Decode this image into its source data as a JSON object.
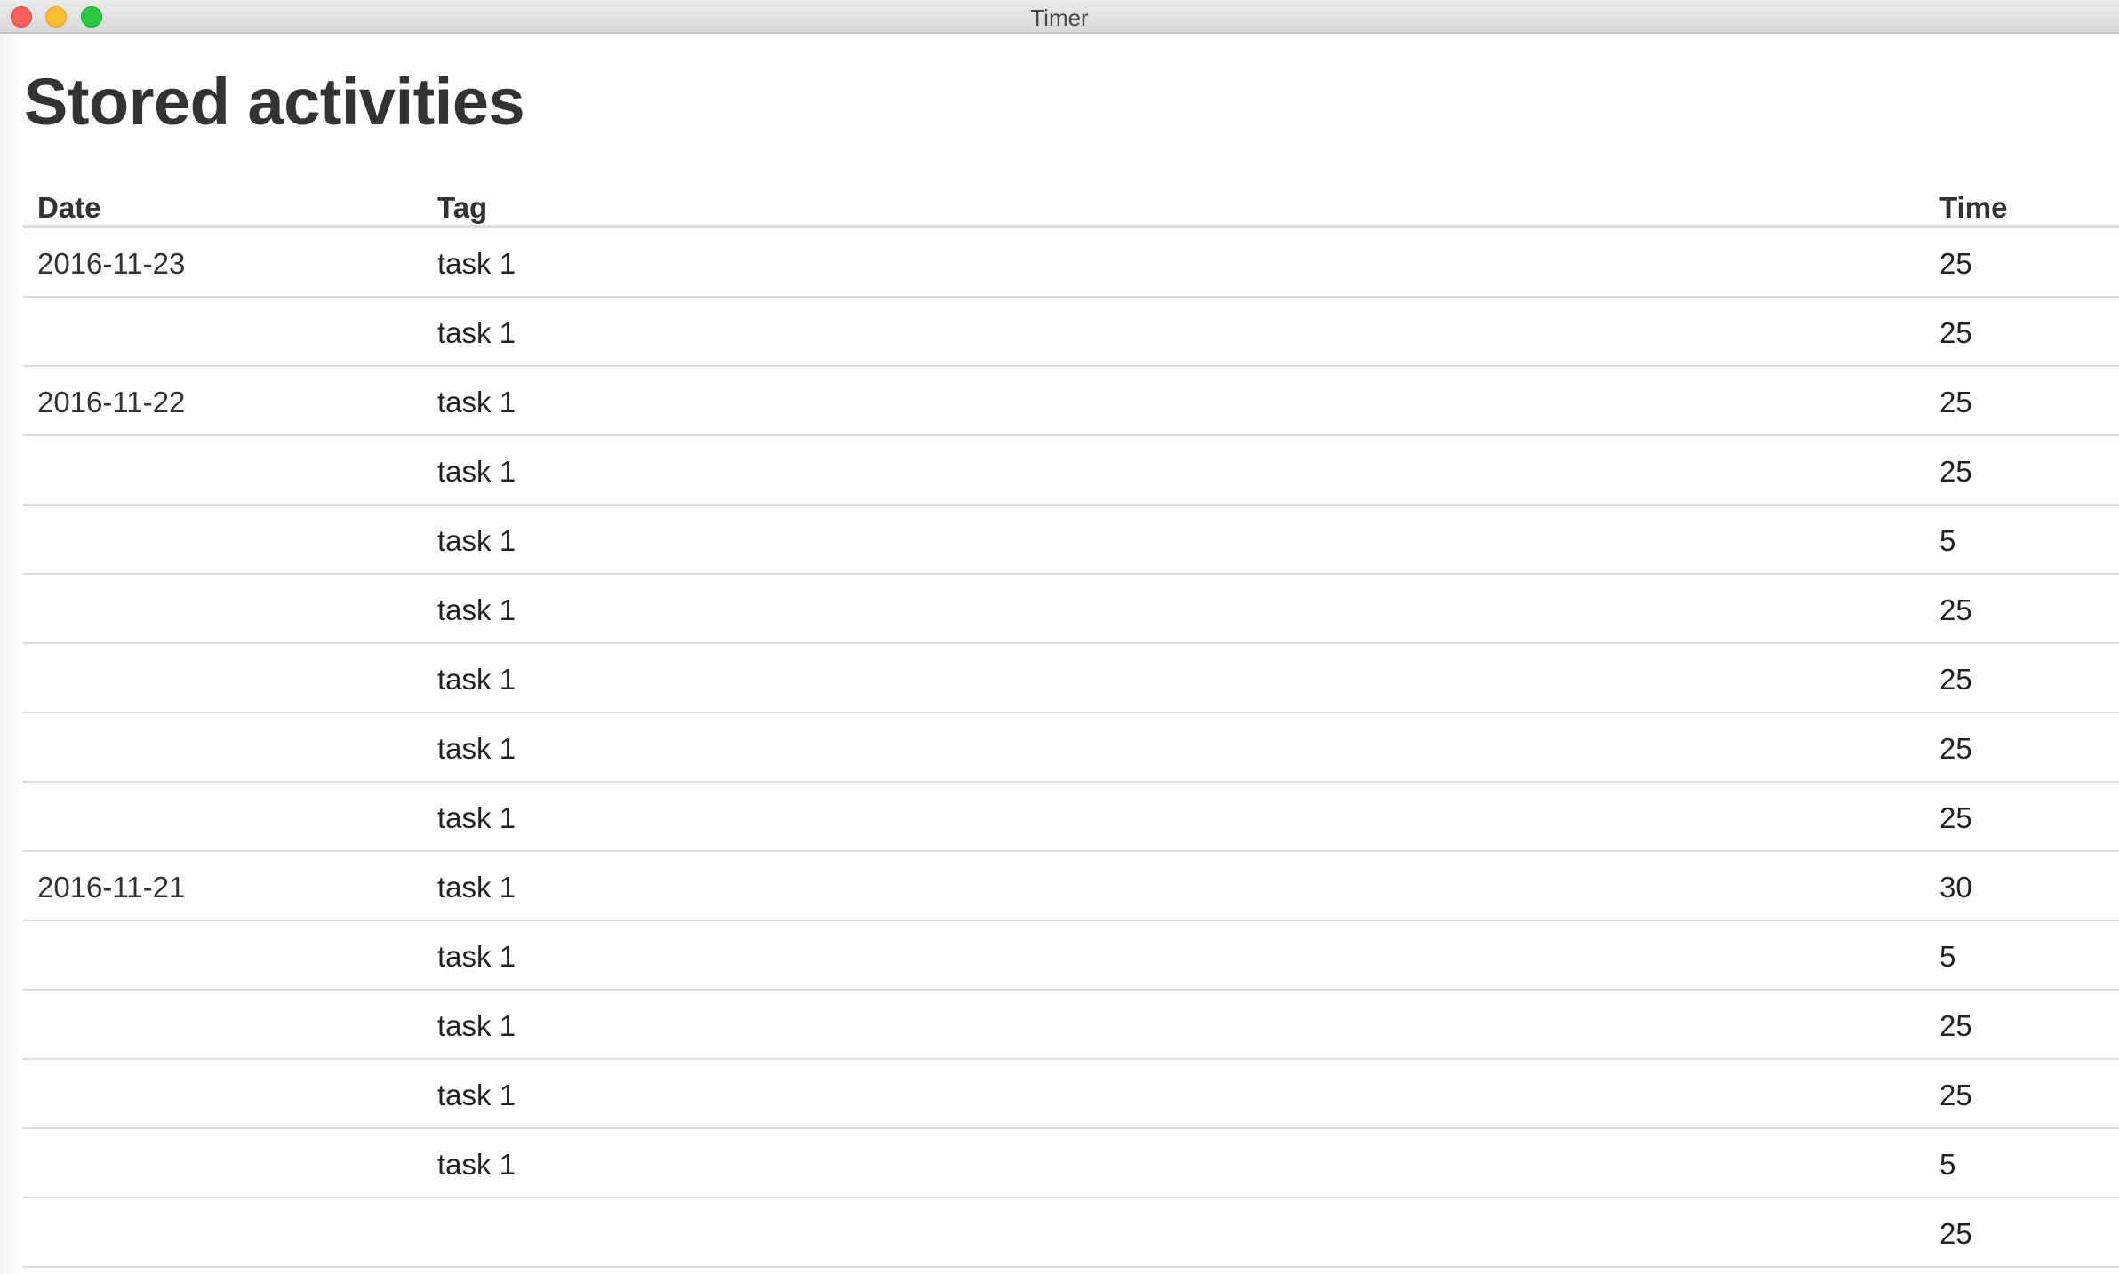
{
  "window": {
    "title": "Timer"
  },
  "page": {
    "title": "Stored activities"
  },
  "table": {
    "headers": {
      "date": "Date",
      "tag": "Tag",
      "time": "Time"
    },
    "rows": [
      {
        "date": "2016-11-23",
        "tag": "task 1",
        "time": "25"
      },
      {
        "date": "",
        "tag": "task 1",
        "time": "25"
      },
      {
        "date": "2016-11-22",
        "tag": "task 1",
        "time": "25"
      },
      {
        "date": "",
        "tag": "task 1",
        "time": "25"
      },
      {
        "date": "",
        "tag": "task 1",
        "time": "5"
      },
      {
        "date": "",
        "tag": "task 1",
        "time": "25"
      },
      {
        "date": "",
        "tag": "task 1",
        "time": "25"
      },
      {
        "date": "",
        "tag": "task 1",
        "time": "25"
      },
      {
        "date": "",
        "tag": "task 1",
        "time": "25"
      },
      {
        "date": "2016-11-21",
        "tag": "task 1",
        "time": "30"
      },
      {
        "date": "",
        "tag": "task 1",
        "time": "5"
      },
      {
        "date": "",
        "tag": "task 1",
        "time": "25"
      },
      {
        "date": "",
        "tag": "task 1",
        "time": "25"
      },
      {
        "date": "",
        "tag": "task 1",
        "time": "5"
      },
      {
        "date": "",
        "tag": "",
        "time": "25"
      }
    ]
  }
}
